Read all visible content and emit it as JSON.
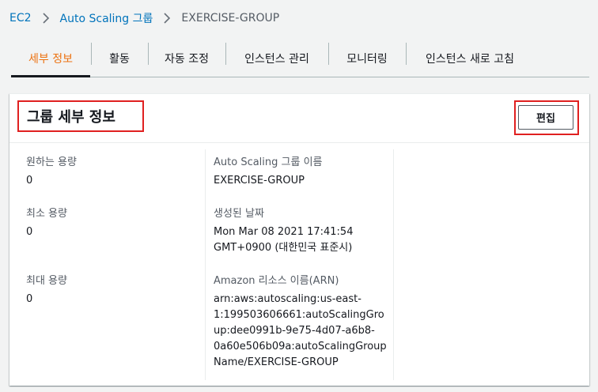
{
  "breadcrumb": {
    "items": [
      "EC2",
      "Auto Scaling 그룹"
    ],
    "current": "EXERCISE-GROUP"
  },
  "tabs": [
    "세부 정보",
    "활동",
    "자동 조정",
    "인스턴스 관리",
    "모니터링",
    "인스턴스 새로 고침"
  ],
  "panel": {
    "title": "그룹 세부 정보",
    "edit_label": "편집"
  },
  "fields": {
    "desired": {
      "label": "원하는 용량",
      "value": "0"
    },
    "min": {
      "label": "최소 용량",
      "value": "0"
    },
    "max": {
      "label": "최대 용량",
      "value": "0"
    },
    "name": {
      "label": "Auto Scaling 그룹 이름",
      "value": "EXERCISE-GROUP"
    },
    "created": {
      "label": "생성된 날짜",
      "lines": [
        "Mon Mar 08 2021 17:41:54",
        "GMT+0900 (대한민국 표준시)"
      ]
    },
    "arn": {
      "label": "Amazon 리소스 이름(ARN)",
      "lines": [
        "arn:aws:autoscaling:us-east-",
        "1:199503606661:autoScalingGro",
        "up:dee0991b-9e75-4d07-a6b8-",
        "0a60e506b09a:autoScalingGroup",
        "Name/EXERCISE-GROUP"
      ]
    }
  },
  "colors": {
    "link": "#0073bb",
    "active_tab": "#ec7211",
    "highlight": "#e02020"
  }
}
